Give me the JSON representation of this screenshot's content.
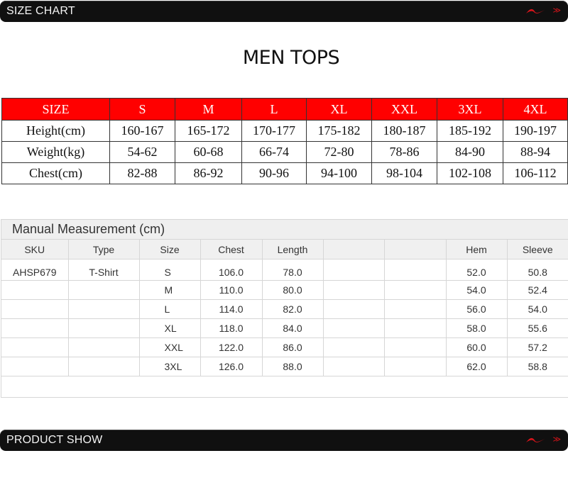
{
  "banner_top": {
    "title": "SIZE CHART",
    "logo": "brand-swoosh-icon",
    "chevrons": "≫"
  },
  "page_title": "MEN TOPS",
  "size_chart": {
    "header": [
      "SIZE",
      "S",
      "M",
      "L",
      "XL",
      "XXL",
      "3XL",
      "4XL"
    ],
    "rows": [
      [
        "Height(cm)",
        "160-167",
        "165-172",
        "170-177",
        "175-182",
        "180-187",
        "185-192",
        "190-197"
      ],
      [
        "Weight(kg)",
        "54-62",
        "60-68",
        "66-74",
        "72-80",
        "78-86",
        "84-90",
        "88-94"
      ],
      [
        "Chest(cm)",
        "82-88",
        "86-92",
        "90-96",
        "94-100",
        "98-104",
        "102-108",
        "106-112"
      ]
    ]
  },
  "manual": {
    "title": "Manual Measurement (cm)",
    "columns": [
      "SKU",
      "Type",
      "Size",
      "Chest",
      "Length",
      "",
      "",
      "Hem",
      "Sleeve"
    ],
    "rows": [
      [
        "AHSP679",
        "T-Shirt",
        "S",
        "106.0",
        "78.0",
        "",
        "",
        "52.0",
        "50.8"
      ],
      [
        "",
        "",
        "M",
        "110.0",
        "80.0",
        "",
        "",
        "54.0",
        "52.4"
      ],
      [
        "",
        "",
        "L",
        "114.0",
        "82.0",
        "",
        "",
        "56.0",
        "54.0"
      ],
      [
        "",
        "",
        "XL",
        "118.0",
        "84.0",
        "",
        "",
        "58.0",
        "55.6"
      ],
      [
        "",
        "",
        "XXL",
        "122.0",
        "86.0",
        "",
        "",
        "60.0",
        "57.2"
      ],
      [
        "",
        "",
        "3XL",
        "126.0",
        "88.0",
        "",
        "",
        "62.0",
        "58.8"
      ]
    ]
  },
  "banner_bottom": {
    "title": "PRODUCT SHOW",
    "logo": "brand-swoosh-icon",
    "chevrons": "≫"
  },
  "colors": {
    "header_red": "#ff0000",
    "banner_black": "#101010",
    "logo_red": "#d7141a"
  }
}
